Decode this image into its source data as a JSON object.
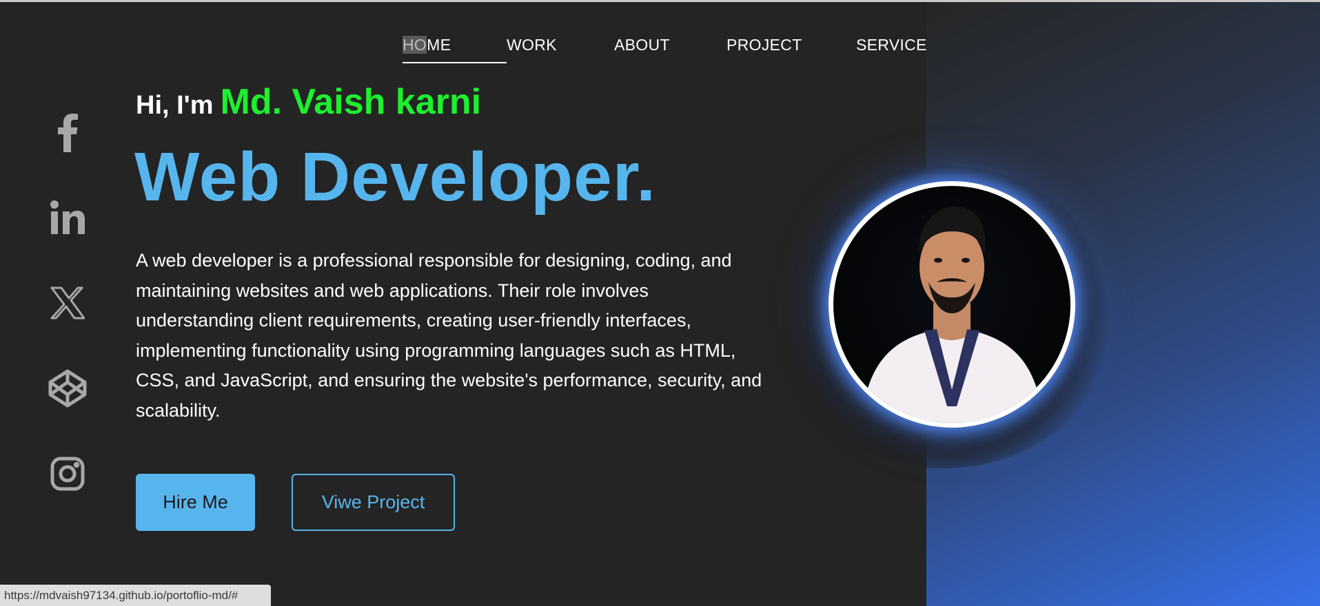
{
  "nav": {
    "items": [
      {
        "label_highlight": "HO",
        "label_rest": "ME",
        "active": true
      },
      {
        "label": "WORK"
      },
      {
        "label": "ABOUT"
      },
      {
        "label": "PROJECT"
      },
      {
        "label": "SERVICE"
      }
    ]
  },
  "hero": {
    "greeting": "Hi, I'm",
    "name": "Md. Vaish karni",
    "role": "Web Developer.",
    "description": "A web developer is a professional responsible for designing, coding, and maintaining websites and web applications. Their role involves understanding client requirements, creating user-friendly interfaces, implementing functionality using programming languages such as HTML, CSS, and JavaScript, and ensuring the website's performance, security, and scalability.",
    "hire_button": "Hire Me",
    "view_button": "Viwe Project"
  },
  "social": [
    "facebook-icon",
    "linkedin-icon",
    "x-icon",
    "codepen-icon",
    "instagram-icon"
  ],
  "status_bar": {
    "url": "https://mdvaish97134.github.io/portoflio-md/#"
  },
  "colors": {
    "background": "#242424",
    "accent_blue": "#57b5ed",
    "name_green": "#1df02e",
    "gradient_end": "#3671ea"
  }
}
